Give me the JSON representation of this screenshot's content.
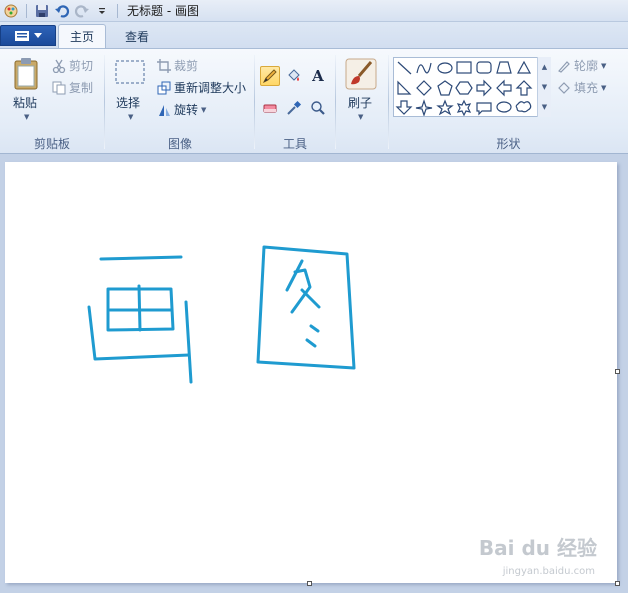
{
  "window": {
    "title": "无标题 - 画图"
  },
  "tabs": [
    {
      "label": "主页"
    },
    {
      "label": "查看"
    }
  ],
  "clipboard": {
    "paste_label": "粘贴",
    "cut_label": "剪切",
    "copy_label": "复制",
    "group_label": "剪贴板"
  },
  "image": {
    "select_label": "选择",
    "crop_label": "裁剪",
    "resize_label": "重新调整大小",
    "rotate_label": "旋转",
    "group_label": "图像"
  },
  "tools": {
    "group_label": "工具",
    "text_tool_glyph": "A"
  },
  "brushes": {
    "label": "刷子"
  },
  "shapes": {
    "outline_label": "轮廓",
    "fill_label": "填充",
    "group_label": "形状"
  },
  "watermark": {
    "line1": "Bai du 经验",
    "line2": "jingyan.baidu.com"
  },
  "colors": {
    "accent": "#1f9bd0",
    "ribbon_bg": "#e3ecf7",
    "app_button": "#2557a7"
  }
}
